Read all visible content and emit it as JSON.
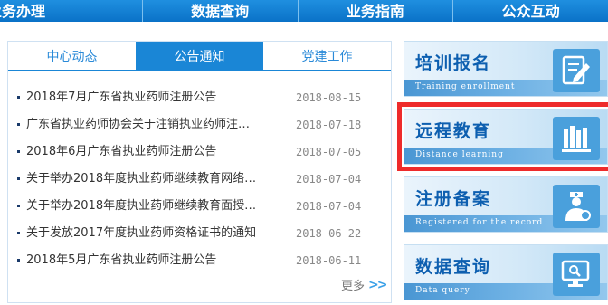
{
  "nav": {
    "items": [
      "业务办理",
      "数据查询",
      "业务指南",
      "公众互动"
    ]
  },
  "tabs": [
    {
      "label": "中心动态",
      "active": false
    },
    {
      "label": "公告通知",
      "active": true
    },
    {
      "label": "党建工作",
      "active": false
    }
  ],
  "news": [
    {
      "title": "2018年7月广东省执业药师注册公告",
      "date": "2018-08-15"
    },
    {
      "title": "广东省执业药师协会关于注销执业药师注…",
      "date": "2018-07-18"
    },
    {
      "title": "2018年6月广东省执业药师注册公告",
      "date": "2018-07-05"
    },
    {
      "title": "关于举办2018年度执业药师继续教育网络…",
      "date": "2018-07-04"
    },
    {
      "title": "关于举办2018年度执业药师继续教育面授…",
      "date": "2018-07-04"
    },
    {
      "title": "关于发放2017年度执业药师资格证书的通知",
      "date": "2018-06-22"
    },
    {
      "title": "2018年5月广东省执业药师注册公告",
      "date": "2018-06-11"
    }
  ],
  "more_label": "更多",
  "cards": [
    {
      "cn": "培训报名",
      "en": "Training enrollment",
      "icon": "pencil-paper-icon"
    },
    {
      "cn": "远程教育",
      "en": "Distance learning",
      "icon": "books-icon",
      "highlighted": true
    },
    {
      "cn": "注册备案",
      "en": "Registered for the record",
      "icon": "doctor-icon"
    },
    {
      "cn": "数据查询",
      "en": "Data query",
      "icon": "monitor-search-icon"
    }
  ],
  "colors": {
    "accent": "#1a86d6",
    "highlight_border": "#ee2b2b",
    "card_title": "#0d5fb0"
  }
}
